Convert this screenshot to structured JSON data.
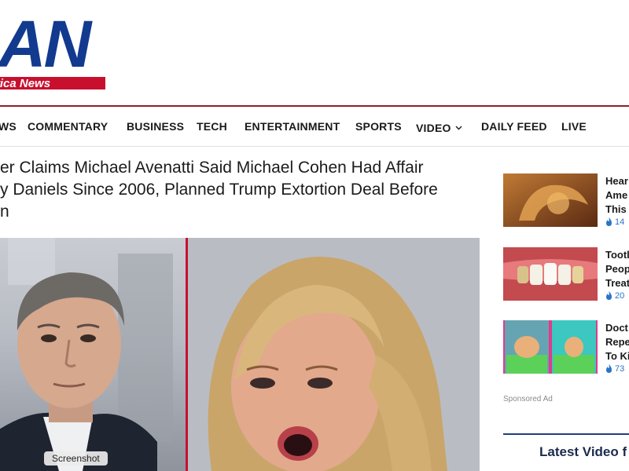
{
  "logo": {
    "letters": "AN",
    "tagline": "rica News",
    "colors": {
      "blue": "#123a8f",
      "red": "#c8102e"
    }
  },
  "nav": {
    "items": [
      {
        "label": "WS"
      },
      {
        "label": "COMMENTARY"
      },
      {
        "label": "BUSINESS"
      },
      {
        "label": "TECH"
      },
      {
        "label": "ENTERTAINMENT"
      },
      {
        "label": "SPORTS"
      },
      {
        "label": "VIDEO",
        "icon": "chevron-down-icon"
      },
      {
        "label": "DAILY FEED"
      },
      {
        "label": "LIVE"
      }
    ]
  },
  "article": {
    "headline_lines": [
      "er Claims Michael Avenatti Said Michael Cohen Had Affair",
      "y Daniels Since 2006, Planned Trump Extortion Deal Before",
      "n"
    ],
    "image_tag": "Screenshot"
  },
  "sidebar": {
    "items": [
      {
        "title_lines": [
          "Hear",
          "Ame",
          "This"
        ],
        "count": "14",
        "icon": "flame-icon"
      },
      {
        "title_lines": [
          "Tootl",
          "Peop",
          "Treat"
        ],
        "count": "20",
        "icon": "flame-icon"
      },
      {
        "title_lines": [
          "Doct",
          "Repe",
          "To Ki"
        ],
        "count": "73",
        "icon": "flame-icon"
      }
    ],
    "sponsored": "Sponsored Ad",
    "latest_video": "Latest Video f"
  }
}
